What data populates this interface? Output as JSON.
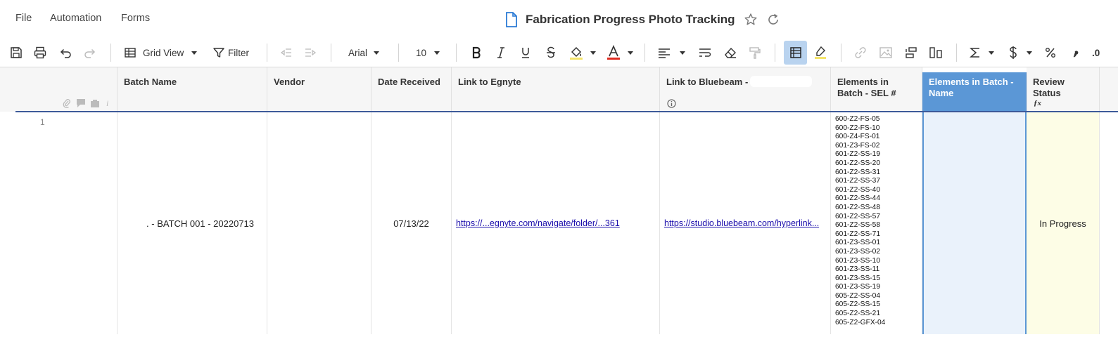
{
  "menu": {
    "file": "File",
    "automation": "Automation",
    "forms": "Forms"
  },
  "sheet": {
    "title": "Fabrication Progress Photo Tracking"
  },
  "toolbar": {
    "view_label": "Grid View",
    "filter_label": "Filter",
    "font_family": "Arial",
    "font_size": "10",
    "decimal_label": ".0"
  },
  "columns": [
    {
      "title": "Batch Name"
    },
    {
      "title": "Vendor"
    },
    {
      "title": "Date Received"
    },
    {
      "title": "Link to Egnyte"
    },
    {
      "title": "Link to Bluebeam -"
    },
    {
      "title": "Elements in Batch - SEL #"
    },
    {
      "title": "Elements in Batch - Name"
    },
    {
      "title": "Review Status"
    }
  ],
  "rows": [
    {
      "row_number": "1",
      "batch_name": ". - BATCH 001 - 20220713",
      "vendor": "",
      "date_received": "07/13/22",
      "egnyte_link": "https://...egnyte.com/navigate/folder/...361",
      "bluebeam_link": "https://studio.bluebeam.com/hyperlink...",
      "elements_sel": [
        "600-Z2-FS-05",
        "600-Z2-FS-10",
        "600-Z4-FS-01",
        "601-Z3-FS-02",
        "601-Z2-SS-19",
        "601-Z2-SS-20",
        "601-Z2-SS-31",
        "601-Z2-SS-37",
        "601-Z2-SS-40",
        "601-Z2-SS-44",
        "601-Z2-SS-48",
        "601-Z2-SS-57",
        "601-Z2-SS-58",
        "601-Z2-SS-71",
        "601-Z3-SS-01",
        "601-Z3-SS-02",
        "601-Z3-SS-10",
        "601-Z3-SS-11",
        "601-Z3-SS-15",
        "601-Z3-SS-19",
        "605-Z2-SS-04",
        "605-Z2-SS-15",
        "605-Z2-SS-21",
        "605-Z2-GFX-04"
      ],
      "elements_name": "",
      "review_status": "In Progress"
    }
  ],
  "colors": {
    "selected_header": "#5b97d6",
    "selected_cell": "#eaf2fb",
    "status_cell": "#fdfde6",
    "link": "#1a0dab"
  },
  "icons": [
    "save-icon",
    "print-icon",
    "undo-icon",
    "redo-icon",
    "grid-icon",
    "filter-icon",
    "bold-icon",
    "italic-icon",
    "underline-icon",
    "strikethrough-icon",
    "fill-color-icon",
    "text-color-icon",
    "align-icon",
    "wrap-icon",
    "eraser-icon",
    "format-painter-icon",
    "card-view-icon",
    "highlight-icon",
    "link-icon",
    "image-icon",
    "indent-icon",
    "outdent-icon",
    "sum-icon",
    "currency-icon",
    "percent-icon",
    "comma-icon"
  ]
}
